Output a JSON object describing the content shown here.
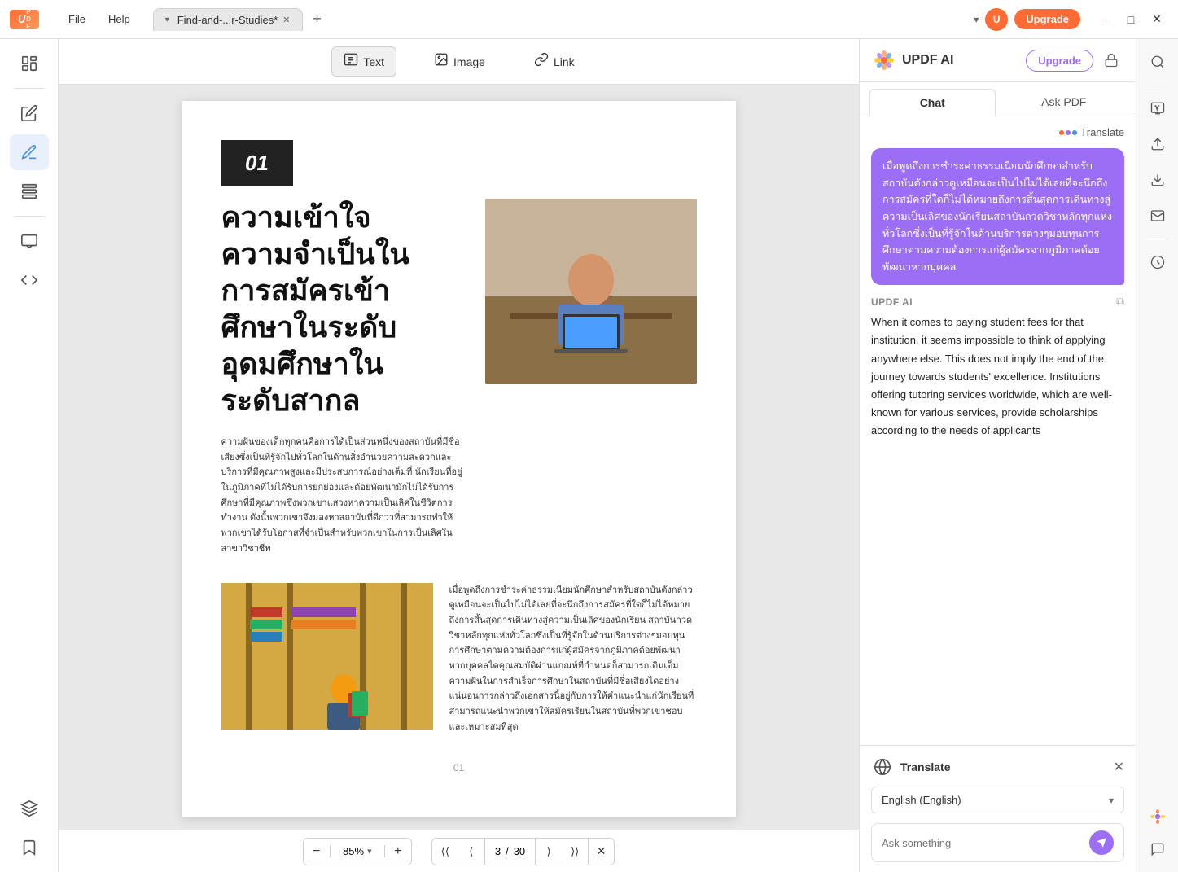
{
  "app": {
    "logo": "UPDF",
    "logo_abbr": "U"
  },
  "titlebar": {
    "menu_items": [
      "File",
      "Help"
    ],
    "tab_dropdown": "▾",
    "tab_label": "Find-and-...r-Studies*",
    "add_tab": "+",
    "dropdown_arrow": "▾",
    "upgrade_label": "Upgrade",
    "avatar_label": "U",
    "minimize": "−",
    "maximize": "□",
    "close": "✕"
  },
  "toolbar": {
    "text_label": "Text",
    "image_label": "Image",
    "link_label": "Link"
  },
  "pdf": {
    "page_number_display": "01",
    "title": "ความเข้าใจความจำเป็นในการสมัครเข้าศึกษาในระดับอุดมศึกษาในระดับสากล",
    "body_text_1": "ความฝันของเด็กทุกคนคือการได้เป็นส่วนหนึ่งของสถาบันที่มีชื่อเสียงซึ่งเป็นที่รู้จักไปทั่วโลกในด้านสิ่งอำนวยความสะดวกและบริการที่มีคุณภาพสูงและมีประสบการณ์อย่างเต็มที่ นักเรียนที่อยู่ในภูมิภาคที่ไม่ได้รับการยกย่องและด้อยพัฒนามักไม่ได้รับการศึกษาที่มีคุณภาพซึ่งพวกเขาแสวงหาความเป็นเลิศในชีวิตการทำงาน ดังนั้นพวกเขาจึงมองหาสถาบันที่ดีกว่าที่สามารถทำให้พวกเขาได้รับโอกาสที่จำเป็นสำหรับพวกเขาในการเป็นเลิศในสาขาวิชาชีพ",
    "body_text_2": "เมื่อพูดถึงการชำระค่าธรรมเนียมนักศึกษาสำหรับสถาบันดังกล่าวดูเหมือนจะเป็นไปไม่ได้เลยที่จะนึกถึงการสมัครที่ใดก็ไม่ได้หมายถึงการสิ้นสุดการเดินทางสู่ความเป็นเลิศของนักเรียน สถาบันกวดวิชาหลักทุกแห่งทั่วโลกซึ่งเป็นที่รู้จักในด้านบริการต่างๆมอบทุนการศึกษาตามความต้องการแก่ผู้สมัครจากภูมิภาคด้อยพัฒนาหากบุคคลไดคุณสมบัติผ่านแกณท์ที่กำหนดก็สามารถเติมเต็มความฝันในการสำเร็จการศึกษาในสถาบันที่มีชื่อเสียงไดอย่างแน่นอนการกล่าวถึงเอกสารนี้อยู่กับการให้คำแนะนำแก่นักเรียนที่สามารถแนะนำพวกเขาให้สมัครเรียนในสถาบันที่พวกเขาชอบและเหมาะสมที่สุด",
    "page_label": "01",
    "current_page": "3",
    "total_pages": "30"
  },
  "bottom_toolbar": {
    "zoom_out": "−",
    "zoom_value": "85%",
    "zoom_dropdown": "▾",
    "zoom_in": "+",
    "nav_first": "⟨⟨",
    "nav_prev": "⟨",
    "nav_next": "⟩",
    "nav_last": "⟩⟩",
    "page_separator": "/",
    "close_icon": "✕"
  },
  "ai_panel": {
    "title": "UPDF AI",
    "upgrade_label": "Upgrade",
    "tabs": {
      "chat": "Chat",
      "ask_pdf": "Ask PDF"
    },
    "translate_label": "Translate",
    "user_message": "เมื่อพูดถึงการชำระค่าธรรมเนียมนักศึกษาสำหรับสถาบันดังกล่าวดูเหมือนจะเป็นไปไม่ได้เลยที่จะนึกถึงการสมัครที่ใดก็ไม่ได้หมายถึงการสิ้นสุดการเดินทางสู่ความเป็นเลิศของนักเรียนสถาบันกวดวิชาหลักทุกแห่งทั่วโลกซึ่งเป็นที่รู้จักในด้านบริการต่างๆมอบทุนการศึกษาตามความต้องการแก่ผู้สมัครจากภูมิภาคด้อยพัฒนาหากบุคคล",
    "ai_response_label": "UPDF AI",
    "ai_response": "When it comes to paying student fees for that institution, it seems impossible to think of applying anywhere else. This does not imply the end of the journey towards students' excellence. Institutions offering tutoring services worldwide, which are well-known for various services, provide scholarships according to the needs of applicants",
    "translate_section": {
      "label": "Translate",
      "language": "English (English)",
      "placeholder": "Ask something"
    }
  },
  "left_sidebar": {
    "icons": [
      "📄",
      "✏️",
      "📝",
      "☰",
      "📋",
      "🔲",
      "🔖"
    ]
  },
  "right_sidebar": {
    "icons": [
      "🔍",
      "−",
      "📷",
      "📤",
      "📧",
      "−",
      "💾",
      "🎨",
      "💬"
    ]
  }
}
